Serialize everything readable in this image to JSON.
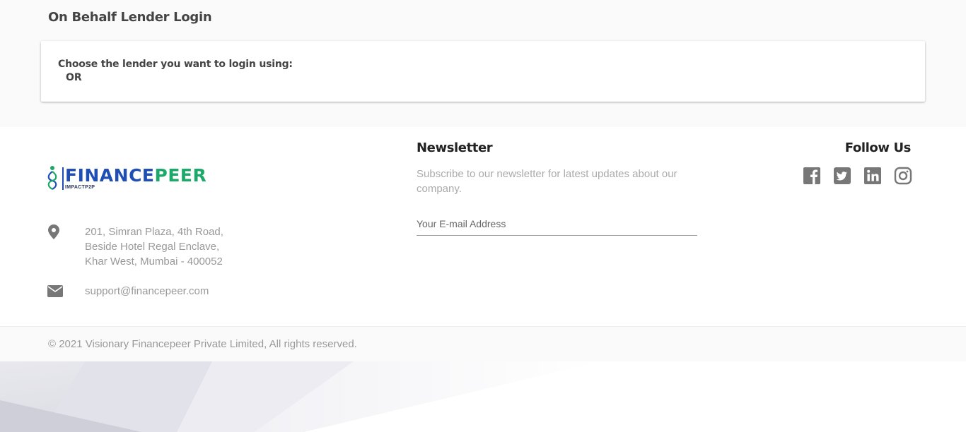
{
  "page": {
    "title": "On Behalf Lender Login"
  },
  "login_card": {
    "prompt": "Choose the lender you want to login using:",
    "separator": "OR"
  },
  "footer": {
    "brand": {
      "name_part1": "FINANCE",
      "name_part2": "PEER",
      "tagline": "IMPACTP2P",
      "colors": {
        "blue": "#1f4fb5",
        "green": "#1aa968"
      }
    },
    "address": {
      "icon": "map-marker-icon",
      "lines": [
        "201, Simran Plaza, 4th Road,",
        "Beside Hotel Regal Enclave,",
        "Khar West, Mumbai - 400052"
      ]
    },
    "email": {
      "icon": "envelope-icon",
      "text": "support@financepeer.com"
    },
    "newsletter": {
      "title": "Newsletter",
      "description": "Subscribe to our newsletter for latest updates about our company.",
      "placeholder": "Your E-mail Address"
    },
    "follow": {
      "title": "Follow Us",
      "networks": [
        "facebook-icon",
        "twitter-icon",
        "linkedin-icon",
        "instagram-icon"
      ]
    },
    "copyright": "© 2021 Visionary Financepeer Private Limited, All rights reserved."
  },
  "theme": {
    "text_dark": "#444444",
    "text_muted": "#999999",
    "icon_gray": "#777777"
  }
}
